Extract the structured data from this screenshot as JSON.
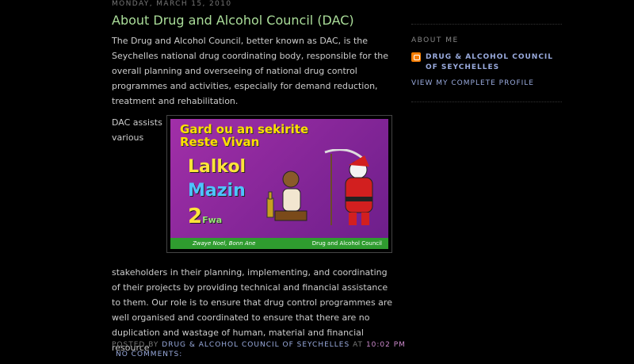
{
  "post": {
    "date": "MONDAY, MARCH 15, 2010",
    "title": "About Drug and Alcohol Council (DAC)",
    "paragraph1": "The Drug and Alcohol Council, better known as DAC, is the Seychelles national drug coordinating body, responsible for the overall planning and overseeing of national drug control programmes and activities, especially for demand reduction, treatment and rehabilitation.",
    "paragraph2": "DAC assists various",
    "paragraph3": "stakeholders in their planning, implementing, and coordinating of their projects by providing technical and financial assistance to them. Our role is to ensure that drug control programmes are well organised and coordinated to ensure that there are no duplication and wastage of human, material and financial resource",
    "posted_by_label": "POSTED BY",
    "author": "DRUG & ALCOHOL COUNCIL OF SEYCHELLES",
    "at_label": "AT",
    "time": "10:02 PM",
    "comments": "NO COMMENTS:"
  },
  "poster": {
    "headline_line1": "Gard ou an sekirite",
    "headline_line2": "Reste Vivan",
    "word1": "Lalkol",
    "word2": "Mazin",
    "word3": "2",
    "word3_small": "Fwa",
    "footer_left": "Zwaye Noel, Bonn Ane",
    "footer_right": "Drug and Alcohol Council"
  },
  "sidebar": {
    "heading": "ABOUT ME",
    "profile_name": "DRUG & ALCOHOL COUNCIL OF SEYCHELLES",
    "view_profile": "VIEW MY COMPLETE PROFILE"
  },
  "colors": {
    "background": "#000000",
    "title": "#aadd99",
    "link": "#99aadd",
    "time": "#cc88cc",
    "blogger_icon": "#f57d00"
  },
  "icons": {
    "profile": "blogger-icon"
  }
}
